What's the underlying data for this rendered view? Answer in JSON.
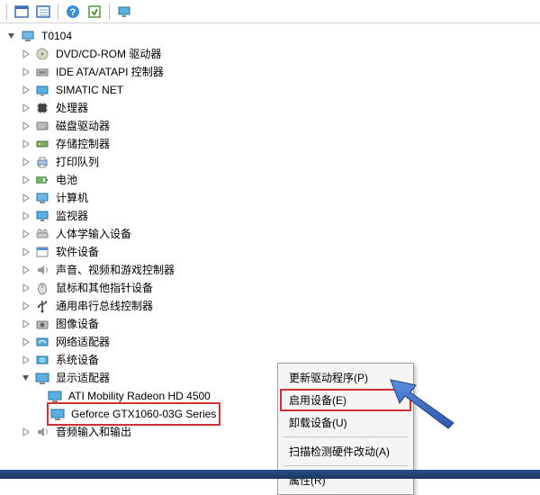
{
  "root": {
    "label": "T0104"
  },
  "categories": [
    {
      "label": "DVD/CD-ROM 驱动器",
      "icon": "disc"
    },
    {
      "label": "IDE ATA/ATAPI 控制器",
      "icon": "ide"
    },
    {
      "label": "SIMATIC NET",
      "icon": "net"
    },
    {
      "label": "处理器",
      "icon": "cpu"
    },
    {
      "label": "磁盘驱动器",
      "icon": "disk"
    },
    {
      "label": "存储控制器",
      "icon": "storage"
    },
    {
      "label": "打印队列",
      "icon": "printer"
    },
    {
      "label": "电池",
      "icon": "battery"
    },
    {
      "label": "计算机",
      "icon": "computer"
    },
    {
      "label": "监视器",
      "icon": "monitor"
    },
    {
      "label": "人体学输入设备",
      "icon": "hid"
    },
    {
      "label": "软件设备",
      "icon": "software"
    },
    {
      "label": "声音、视频和游戏控制器",
      "icon": "sound"
    },
    {
      "label": "鼠标和其他指针设备",
      "icon": "mouse"
    },
    {
      "label": "通用串行总线控制器",
      "icon": "usb"
    },
    {
      "label": "图像设备",
      "icon": "camera"
    },
    {
      "label": "网络适配器",
      "icon": "netadapter"
    },
    {
      "label": "系统设备",
      "icon": "system"
    }
  ],
  "display_adapter": {
    "label": "显示适配器",
    "children": [
      {
        "label": "ATI Mobility Radeon HD 4500"
      },
      {
        "label": "Geforce GTX1060-03G Series"
      }
    ]
  },
  "audio": {
    "label": "音频输入和输出"
  },
  "context_menu": {
    "items": [
      {
        "label": "更新驱动程序(P)"
      },
      {
        "label": "启用设备(E)",
        "highlighted": true
      },
      {
        "label": "卸载设备(U)"
      },
      {
        "sep": true
      },
      {
        "label": "扫描检测硬件改动(A)"
      },
      {
        "sep": true
      },
      {
        "label": "属性(R)"
      }
    ]
  }
}
